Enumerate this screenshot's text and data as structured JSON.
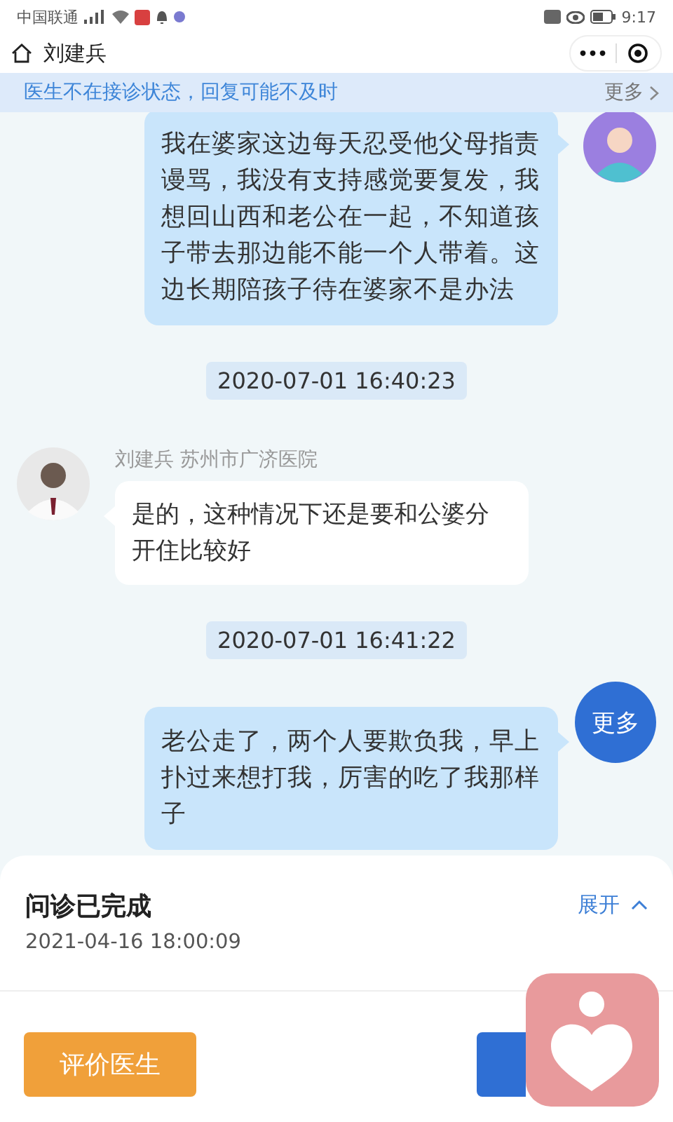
{
  "status_bar": {
    "carrier": "中国联通",
    "time": "9:17"
  },
  "nav": {
    "title": "刘建兵",
    "menu_label": "•••"
  },
  "notice": {
    "text": "医生不在接诊状态，回复可能不及时",
    "more": "更多"
  },
  "messages": [
    {
      "kind": "patient",
      "text": "我在婆家这边每天忍受他父母指责谩骂，我没有支持感觉要复发，我想回山西和老公在一起，不知道孩子带去那边能不能一个人带着。这边长期陪孩子待在婆家不是办法"
    },
    {
      "kind": "time",
      "text": "2020-07-01 16:40:23"
    },
    {
      "kind": "doctor",
      "sender": "刘建兵 苏州市广济医院",
      "text": "是的，这种情况下还是要和公婆分开住比较好"
    },
    {
      "kind": "time",
      "text": "2020-07-01 16:41:22"
    },
    {
      "kind": "patient",
      "text": "老公走了，两个人要欺负我，早上扑过来想打我，厉害的吃了我那样子",
      "more": "更多"
    }
  ],
  "summary": {
    "title": "问诊已完成",
    "date": "2021-04-16 18:00:09",
    "toggle": "展开",
    "expanded": false
  },
  "actions": [
    {
      "kind": "secondary",
      "label": "评价医生"
    },
    {
      "kind": "primary"
    }
  ]
}
